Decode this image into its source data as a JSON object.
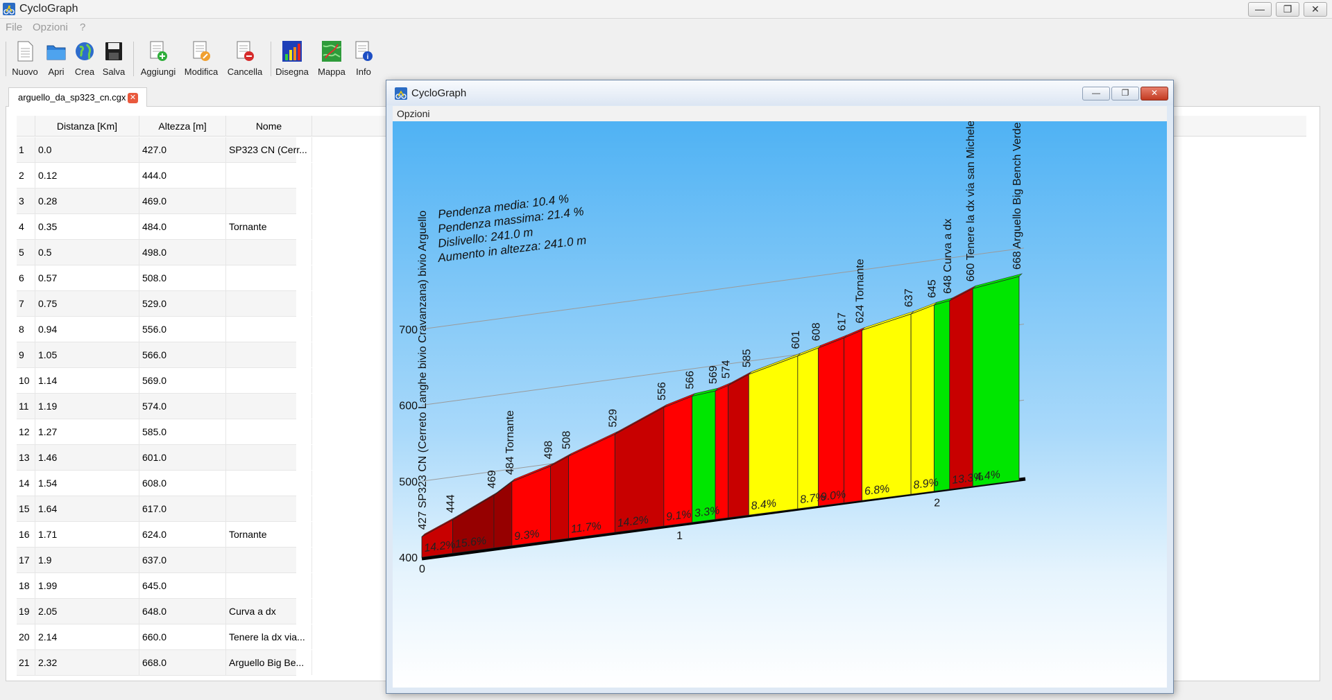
{
  "window": {
    "title": "CycloGraph",
    "controls": {
      "minimize": "—",
      "restore": "❐",
      "close": "✕"
    }
  },
  "menubar": {
    "file": "File",
    "options": "Opzioni",
    "help": "?"
  },
  "toolbar": {
    "nuovo": "Nuovo",
    "apri": "Apri",
    "crea": "Crea",
    "salva": "Salva",
    "aggiungi": "Aggiungi",
    "modifica": "Modifica",
    "cancella": "Cancella",
    "disegna": "Disegna",
    "mappa": "Mappa",
    "info": "Info"
  },
  "doc_tab": {
    "label": "arguello_da_sp323_cn.cgx",
    "close": "✕"
  },
  "table": {
    "headers": [
      "Distanza [Km]",
      "Altezza [m]",
      "Nome"
    ],
    "rows": [
      {
        "n": "1",
        "d": "0.0",
        "a": "427.0",
        "name": "SP323 CN (Cerr..."
      },
      {
        "n": "2",
        "d": "0.12",
        "a": "444.0",
        "name": ""
      },
      {
        "n": "3",
        "d": "0.28",
        "a": "469.0",
        "name": ""
      },
      {
        "n": "4",
        "d": "0.35",
        "a": "484.0",
        "name": "Tornante"
      },
      {
        "n": "5",
        "d": "0.5",
        "a": "498.0",
        "name": ""
      },
      {
        "n": "6",
        "d": "0.57",
        "a": "508.0",
        "name": ""
      },
      {
        "n": "7",
        "d": "0.75",
        "a": "529.0",
        "name": ""
      },
      {
        "n": "8",
        "d": "0.94",
        "a": "556.0",
        "name": ""
      },
      {
        "n": "9",
        "d": "1.05",
        "a": "566.0",
        "name": ""
      },
      {
        "n": "10",
        "d": "1.14",
        "a": "569.0",
        "name": ""
      },
      {
        "n": "11",
        "d": "1.19",
        "a": "574.0",
        "name": ""
      },
      {
        "n": "12",
        "d": "1.27",
        "a": "585.0",
        "name": ""
      },
      {
        "n": "13",
        "d": "1.46",
        "a": "601.0",
        "name": ""
      },
      {
        "n": "14",
        "d": "1.54",
        "a": "608.0",
        "name": ""
      },
      {
        "n": "15",
        "d": "1.64",
        "a": "617.0",
        "name": ""
      },
      {
        "n": "16",
        "d": "1.71",
        "a": "624.0",
        "name": "Tornante"
      },
      {
        "n": "17",
        "d": "1.9",
        "a": "637.0",
        "name": ""
      },
      {
        "n": "18",
        "d": "1.99",
        "a": "645.0",
        "name": ""
      },
      {
        "n": "19",
        "d": "2.05",
        "a": "648.0",
        "name": "Curva a dx"
      },
      {
        "n": "20",
        "d": "2.14",
        "a": "660.0",
        "name": "Tenere la dx via..."
      },
      {
        "n": "21",
        "d": "2.32",
        "a": "668.0",
        "name": "Arguello Big Be..."
      }
    ]
  },
  "chart_window": {
    "title": "CycloGraph",
    "menu": "Opzioni",
    "controls": {
      "minimize": "—",
      "restore": "❐",
      "close": "✕"
    }
  },
  "chart_data": {
    "type": "area",
    "stats": [
      "Pendenza media: 10.4 %",
      "Pendenza massima: 21.4 %",
      "Dislivello: 241.0 m",
      "Aumento in altezza: 241.0 m"
    ],
    "y_ticks": [
      400,
      500,
      600,
      700
    ],
    "x_ticks": [
      0,
      1,
      2
    ],
    "ylim": [
      400,
      700
    ],
    "xlim": [
      0,
      2.32
    ],
    "colors": {
      "red": "#ff0000",
      "darkred": "#c80000",
      "maroon": "#960000",
      "green": "#00e600",
      "yellow": "#ffff00"
    },
    "points": [
      {
        "x": 0.0,
        "y": 427,
        "label": "427 SP323 CN (Cerreto Langhe bivio Cravanzana) bivio Arguello"
      },
      {
        "x": 0.12,
        "y": 444,
        "label": "444"
      },
      {
        "x": 0.28,
        "y": 469,
        "label": "469"
      },
      {
        "x": 0.35,
        "y": 484,
        "label": "484 Tornante"
      },
      {
        "x": 0.5,
        "y": 498,
        "label": "498"
      },
      {
        "x": 0.57,
        "y": 508,
        "label": "508"
      },
      {
        "x": 0.75,
        "y": 529,
        "label": "529"
      },
      {
        "x": 0.94,
        "y": 556,
        "label": "556"
      },
      {
        "x": 1.05,
        "y": 566,
        "label": "566"
      },
      {
        "x": 1.14,
        "y": 569,
        "label": "569"
      },
      {
        "x": 1.19,
        "y": 574,
        "label": "574"
      },
      {
        "x": 1.27,
        "y": 585,
        "label": "585"
      },
      {
        "x": 1.46,
        "y": 601,
        "label": "601"
      },
      {
        "x": 1.54,
        "y": 608,
        "label": "608"
      },
      {
        "x": 1.64,
        "y": 617,
        "label": "617"
      },
      {
        "x": 1.71,
        "y": 624,
        "label": "624 Tornante"
      },
      {
        "x": 1.9,
        "y": 637,
        "label": "637"
      },
      {
        "x": 1.99,
        "y": 645,
        "label": "645"
      },
      {
        "x": 2.05,
        "y": 648,
        "label": "648 Curva a dx"
      },
      {
        "x": 2.14,
        "y": 660,
        "label": "660 Tenere la dx via san Michele"
      },
      {
        "x": 2.32,
        "y": 668,
        "label": "668 Arguello Big Bench Verde"
      }
    ],
    "segments": [
      {
        "slope": "14.2%",
        "color": "darkred"
      },
      {
        "slope": "15.6%",
        "color": "maroon"
      },
      {
        "slope": "",
        "color": "maroon"
      },
      {
        "slope": "9.3%",
        "color": "red"
      },
      {
        "slope": "",
        "color": "darkred"
      },
      {
        "slope": "11.7%",
        "color": "red"
      },
      {
        "slope": "14.2%",
        "color": "darkred"
      },
      {
        "slope": "9.1%",
        "color": "red"
      },
      {
        "slope": "3.3%",
        "color": "green"
      },
      {
        "slope": "",
        "color": "red"
      },
      {
        "slope": "",
        "color": "darkred"
      },
      {
        "slope": "8.4%",
        "color": "yellow"
      },
      {
        "slope": "8.7%",
        "color": "yellow"
      },
      {
        "slope": "9.0%",
        "color": "red"
      },
      {
        "slope": "",
        "color": "red"
      },
      {
        "slope": "6.8%",
        "color": "yellow"
      },
      {
        "slope": "8.9%",
        "color": "yellow"
      },
      {
        "slope": "",
        "color": "green"
      },
      {
        "slope": "13.3%",
        "color": "darkred"
      },
      {
        "slope": "4.4%",
        "color": "green"
      }
    ]
  }
}
